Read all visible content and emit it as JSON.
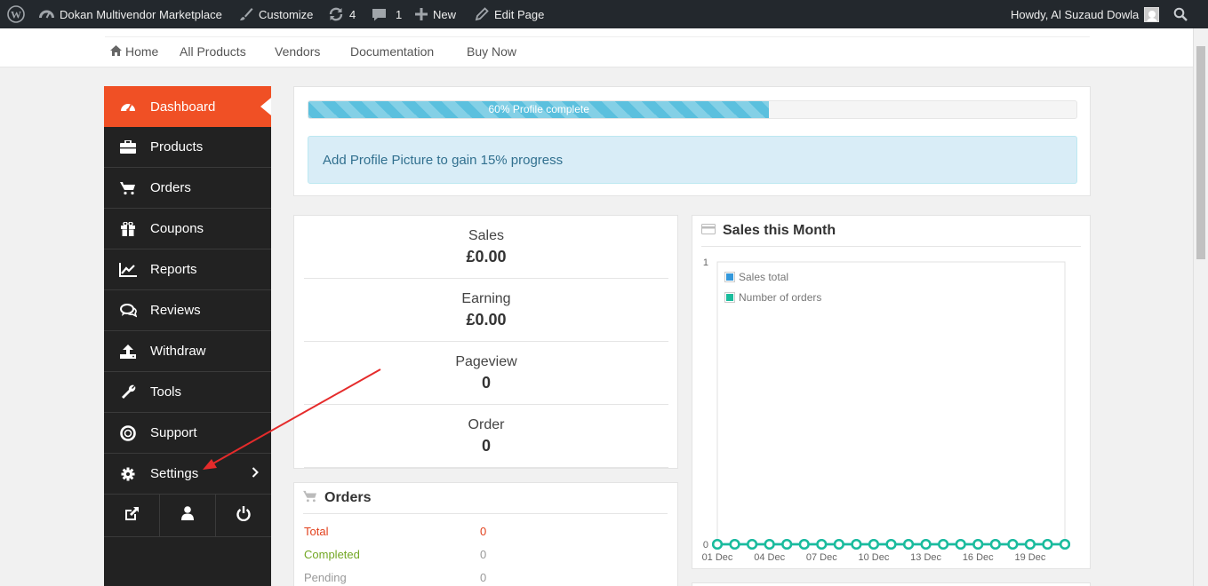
{
  "adminbar": {
    "site_name": "Dokan Multivendor Marketplace",
    "customize": "Customize",
    "updates_count": "4",
    "comments_count": "1",
    "new_label": "New",
    "edit_label": "Edit Page",
    "howdy": "Howdy, Al Suzaud Dowla"
  },
  "topnav": {
    "home": "Home",
    "all_products": "All Products",
    "vendors": "Vendors",
    "documentation": "Documentation",
    "buy_now": "Buy Now"
  },
  "sidebar": {
    "items": [
      {
        "label": "Dashboard",
        "icon": "dashboard-icon"
      },
      {
        "label": "Products",
        "icon": "briefcase-icon"
      },
      {
        "label": "Orders",
        "icon": "cart-icon"
      },
      {
        "label": "Coupons",
        "icon": "gift-icon"
      },
      {
        "label": "Reports",
        "icon": "line-chart-icon"
      },
      {
        "label": "Reviews",
        "icon": "comments-icon"
      },
      {
        "label": "Withdraw",
        "icon": "upload-icon"
      },
      {
        "label": "Tools",
        "icon": "wrench-icon"
      },
      {
        "label": "Support",
        "icon": "life-ring-icon"
      },
      {
        "label": "Settings",
        "icon": "gear-icon"
      }
    ],
    "active_color": "#f05025",
    "bottom_icons": [
      "external-link-icon",
      "user-icon",
      "power-icon"
    ]
  },
  "profile": {
    "progress_percent": 60,
    "progress_label": "60% Profile complete",
    "tip": "Add Profile Picture to gain 15% progress"
  },
  "stats": [
    {
      "label": "Sales",
      "value": "£0.00"
    },
    {
      "label": "Earning",
      "value": "£0.00"
    },
    {
      "label": "Pageview",
      "value": "0"
    },
    {
      "label": "Order",
      "value": "0"
    }
  ],
  "orders": {
    "title": "Orders",
    "rows": [
      {
        "label": "Total",
        "value": "0",
        "color": "#e2401c"
      },
      {
        "label": "Completed",
        "value": "0",
        "color": "#73a724"
      },
      {
        "label": "Pending",
        "value": "0",
        "color": "#999999"
      }
    ]
  },
  "sales_chart": {
    "title": "Sales this Month",
    "chart_data": {
      "type": "line",
      "x": [
        "01 Dec",
        "02 Dec",
        "03 Dec",
        "04 Dec",
        "05 Dec",
        "06 Dec",
        "07 Dec",
        "08 Dec",
        "09 Dec",
        "10 Dec",
        "11 Dec",
        "12 Dec",
        "13 Dec",
        "14 Dec",
        "15 Dec",
        "16 Dec",
        "17 Dec",
        "18 Dec",
        "19 Dec",
        "20 Dec",
        "21 Dec"
      ],
      "x_tick_labels": [
        "01 Dec",
        "04 Dec",
        "07 Dec",
        "10 Dec",
        "13 Dec",
        "16 Dec",
        "19 Dec"
      ],
      "series": [
        {
          "name": "Sales total",
          "color": "#3498db",
          "values": [
            0,
            0,
            0,
            0,
            0,
            0,
            0,
            0,
            0,
            0,
            0,
            0,
            0,
            0,
            0,
            0,
            0,
            0,
            0,
            0,
            0
          ]
        },
        {
          "name": "Number of orders",
          "color": "#1abc9c",
          "values": [
            0,
            0,
            0,
            0,
            0,
            0,
            0,
            0,
            0,
            0,
            0,
            0,
            0,
            0,
            0,
            0,
            0,
            0,
            0,
            0,
            0
          ]
        }
      ],
      "ylim": [
        0,
        1
      ],
      "y_ticks": [
        "0",
        "1"
      ],
      "legend": "top-left"
    }
  }
}
